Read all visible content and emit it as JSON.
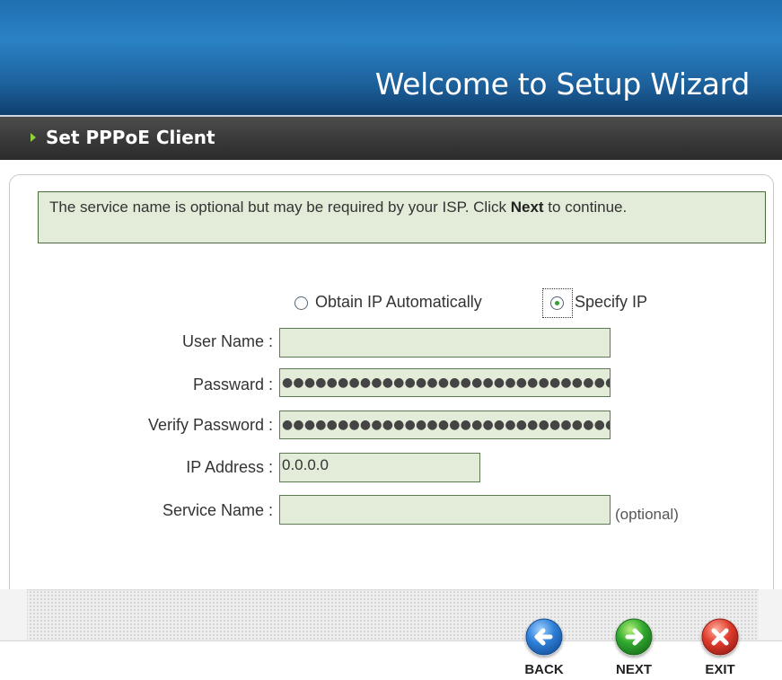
{
  "banner": {
    "title": "Welcome to Setup Wizard"
  },
  "section": {
    "title": "Set PPPoE Client"
  },
  "info": {
    "text_before": "The service name is optional but may be required by your ISP. Click ",
    "text_bold": "Next",
    "text_after": " to continue."
  },
  "ip_mode": {
    "options": [
      {
        "label": "Obtain IP Automatically",
        "selected": false
      },
      {
        "label": "Specify IP",
        "selected": true
      }
    ]
  },
  "form": {
    "user_name": {
      "label": "User Name :",
      "value": ""
    },
    "password": {
      "label": "Passward :",
      "value": "●●●●●●●●●●●●●●●●●●●●●●●●●●●●●●●●●●●"
    },
    "verify_password": {
      "label": "Verify Password :",
      "value": "●●●●●●●●●●●●●●●●●●●●●●●●●●●●●●●●●●●"
    },
    "ip_address": {
      "label": "IP Address :",
      "value": "0.0.0.0"
    },
    "service_name": {
      "label": "Service Name :",
      "value": "",
      "hint": "(optional)"
    }
  },
  "nav": {
    "back": {
      "label": "BACK",
      "icon": "arrow-left-icon",
      "color": "#2e7fd8"
    },
    "next": {
      "label": "NEXT",
      "icon": "arrow-right-icon",
      "color": "#2fa82f"
    },
    "exit": {
      "label": "EXIT",
      "icon": "close-icon",
      "color": "#e03c2c"
    }
  }
}
